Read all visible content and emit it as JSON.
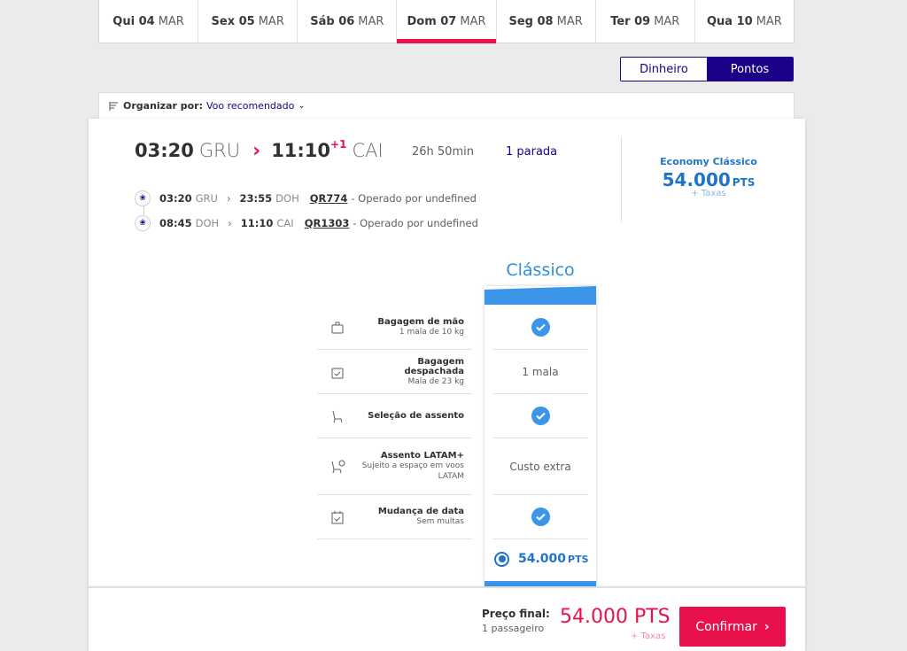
{
  "dates": [
    {
      "day": "Qui 04",
      "month": "MAR"
    },
    {
      "day": "Sex 05",
      "month": "MAR"
    },
    {
      "day": "Sáb 06",
      "month": "MAR"
    },
    {
      "day": "Dom 07",
      "month": "MAR"
    },
    {
      "day": "Seg 08",
      "month": "MAR"
    },
    {
      "day": "Ter 09",
      "month": "MAR"
    },
    {
      "day": "Qua 10",
      "month": "MAR"
    }
  ],
  "currency": {
    "money_label": "Dinheiro",
    "points_label": "Pontos"
  },
  "sort": {
    "label": "Organizar por:",
    "value": "Voo recomendado"
  },
  "flight": {
    "depart_time": "03:20",
    "depart_code": "GRU",
    "arrive_time": "11:10",
    "day_offset": "+1",
    "arrive_code": "CAI",
    "duration": "26h 50min",
    "stops": "1 parada",
    "segments": [
      {
        "dep_time": "03:20",
        "dep_code": "GRU",
        "arr_time": "23:55",
        "arr_code": "DOH",
        "flight_no": "QR774",
        "operator": "- Operado por undefined"
      },
      {
        "dep_time": "08:45",
        "dep_code": "DOH",
        "arr_time": "11:10",
        "arr_code": "CAI",
        "flight_no": "QR1303",
        "operator": "- Operado por undefined"
      }
    ]
  },
  "fare_summary": {
    "name": "Economy Clássico",
    "price": "54.000",
    "unit": "PTS",
    "taxes": "+ Taxas"
  },
  "benefits": [
    {
      "title": "Bagagem de mão",
      "subtitle": "1 mala de 10 kg",
      "icon": "hand-bag-icon",
      "value_type": "check",
      "value": ""
    },
    {
      "title": "Bagagem despachada",
      "subtitle": "Mala de 23 kg",
      "icon": "checked-bag-icon",
      "value_type": "text",
      "value": "1 mala"
    },
    {
      "title": "Seleção de assento",
      "subtitle": "",
      "icon": "seat-icon",
      "value_type": "check",
      "value": ""
    },
    {
      "title": "Assento LATAM+",
      "subtitle": "Sujeito a espaço em voos LATAM",
      "icon": "seat-plus-icon",
      "value_type": "text",
      "value": "Custo extra"
    },
    {
      "title": "Mudança de data",
      "subtitle": "Sem multas",
      "icon": "calendar-icon",
      "value_type": "check",
      "value": ""
    }
  ],
  "fare_column": {
    "title": "Clássico",
    "price": "54.000",
    "unit": "PTS"
  },
  "footer": {
    "label": "Preço final:",
    "passengers": "1 passageiro",
    "price": "54.000 PTS",
    "taxes": "+ Taxas",
    "confirm_label": "Confirmar"
  },
  "colors": {
    "brand_red": "#e8114b",
    "brand_navy": "#1b0088",
    "fare_blue": "#3b95e8"
  }
}
